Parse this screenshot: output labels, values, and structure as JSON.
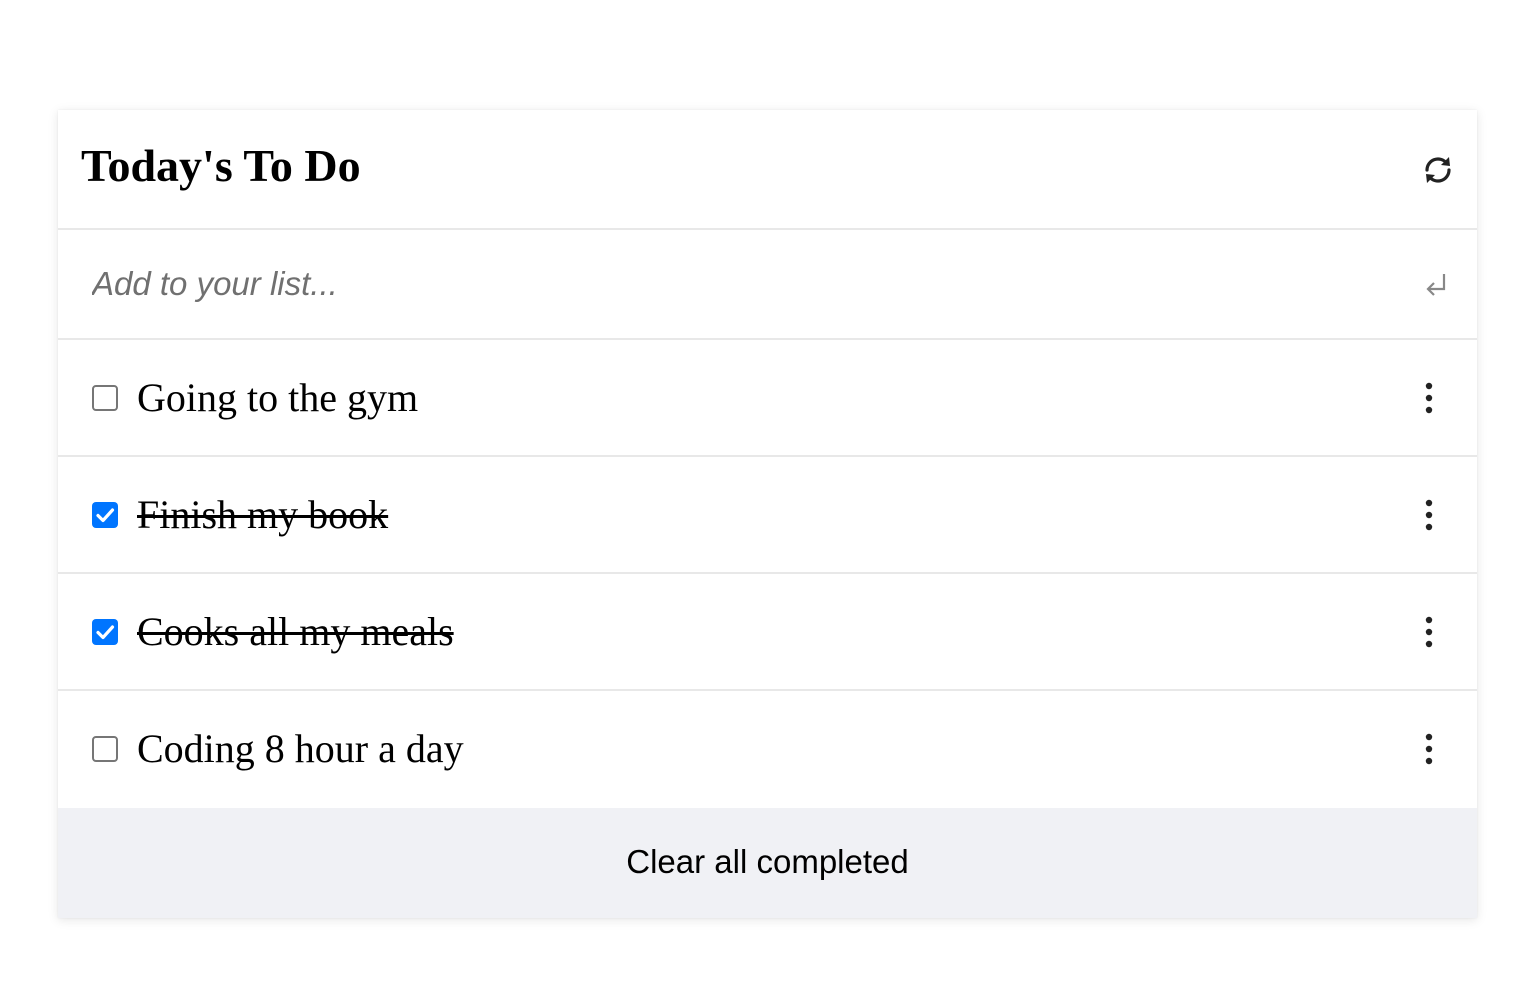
{
  "header": {
    "title": "Today's To Do",
    "refresh_icon": "refresh-icon"
  },
  "add": {
    "placeholder": "Add to your list...",
    "value": "",
    "submit_icon": "enter-return-icon"
  },
  "items": [
    {
      "label": "Going to the gym",
      "completed": false,
      "menu_icon": "more-vertical-icon"
    },
    {
      "label": "Finish my book",
      "completed": true,
      "menu_icon": "more-vertical-icon"
    },
    {
      "label": "Cooks all my meals",
      "completed": true,
      "menu_icon": "more-vertical-icon"
    },
    {
      "label": "Coding 8 hour a day",
      "completed": false,
      "menu_icon": "more-vertical-icon"
    }
  ],
  "footer": {
    "clear_label": "Clear all completed"
  },
  "colors": {
    "checkbox_checked": "#0075ff",
    "footer_bg": "#f0f1f5",
    "divider": "#e8e8e8"
  }
}
